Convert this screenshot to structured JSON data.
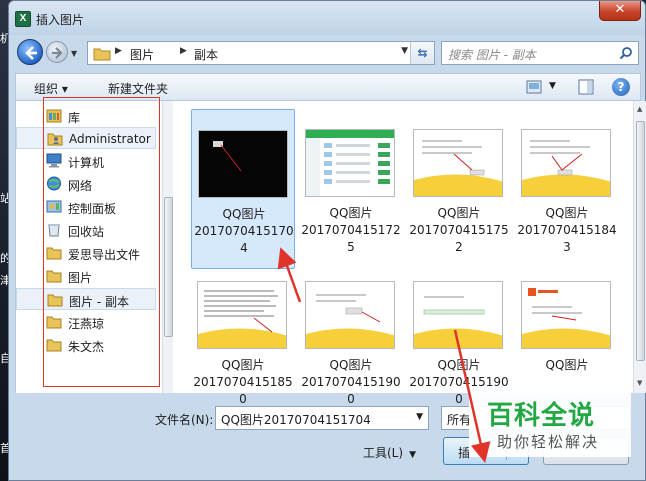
{
  "window": {
    "title": "插入图片",
    "app_icon_letter": "X",
    "close_glyph": "✕"
  },
  "background_strip": [
    "机",
    "站",
    "的",
    "津",
    "自",
    "首"
  ],
  "nav": {
    "path": [
      "图片",
      "副本"
    ],
    "search_placeholder": "搜索 图片 - 副本"
  },
  "toolbar": {
    "organize_label": "组织 ▾",
    "new_folder_label": "新建文件夹"
  },
  "sidebar": {
    "items": [
      {
        "label": "库",
        "icon": "library-icon"
      },
      {
        "label": "Administrator",
        "icon": "user-folder-icon"
      },
      {
        "label": "计算机",
        "icon": "computer-icon"
      },
      {
        "label": "网络",
        "icon": "network-icon"
      },
      {
        "label": "控制面板",
        "icon": "control-panel-icon"
      },
      {
        "label": "回收站",
        "icon": "recycle-bin-icon"
      },
      {
        "label": "爱思导出文件",
        "icon": "folder-icon"
      },
      {
        "label": "图片",
        "icon": "folder-icon"
      },
      {
        "label": "图片 - 副本",
        "icon": "folder-icon"
      },
      {
        "label": "汪燕琼",
        "icon": "folder-icon"
      },
      {
        "label": "朱文杰",
        "icon": "folder-icon"
      }
    ]
  },
  "files": [
    {
      "line1": "QQ图片",
      "line2": "2017070415170",
      "line3": "4",
      "thumb": "black"
    },
    {
      "line1": "QQ图片",
      "line2": "2017070415172",
      "line3": "5",
      "thumb": "app-list"
    },
    {
      "line1": "QQ图片",
      "line2": "2017070415175",
      "line3": "2",
      "thumb": "dialog-yellow"
    },
    {
      "line1": "QQ图片",
      "line2": "2017070415184",
      "line3": "3",
      "thumb": "dialog-yellow"
    },
    {
      "line1": "QQ图片",
      "line2": "20170704151850",
      "line3": "",
      "thumb": "doc-yellow"
    },
    {
      "line1": "QQ图片",
      "line2": "20170704151900",
      "line3": "",
      "thumb": "dialog-yellow"
    },
    {
      "line1": "QQ图片",
      "line2": "20170704151900",
      "line3": "",
      "thumb": "progress-yellow"
    },
    {
      "line1": "QQ图片",
      "line2": "",
      "line3": "",
      "thumb": "office-yellow"
    }
  ],
  "bottom": {
    "filename_label": "文件名(N):",
    "filename_value": "QQ图片20170704151704",
    "filetype_value": "所有",
    "tools_label": "工具(L)",
    "insert_label": "插"
  },
  "watermark": {
    "title": "百科全说",
    "subtitle": "助你轻松解决"
  },
  "colors": {
    "annotation_red": "#e0342a",
    "watermark_green": "#22a843",
    "selection": "#d6e8fb"
  }
}
